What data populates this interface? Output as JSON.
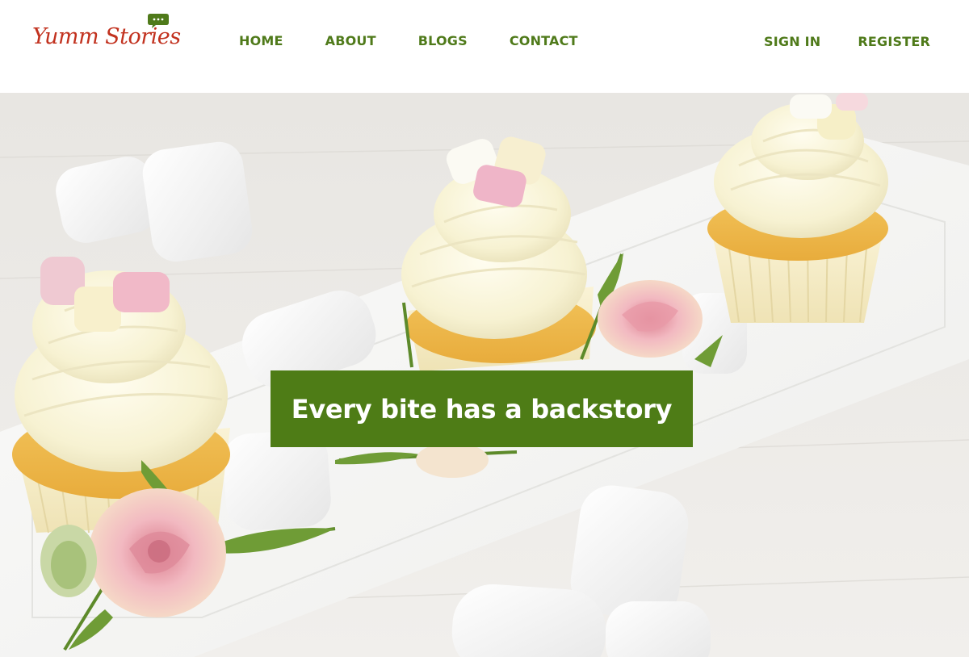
{
  "brand": {
    "logo_text": "Yumm Stories"
  },
  "nav": {
    "items": [
      {
        "label": "HOME"
      },
      {
        "label": "ABOUT"
      },
      {
        "label": "BLOGS"
      },
      {
        "label": "CONTACT"
      }
    ]
  },
  "auth": {
    "sign_in": "SIGN IN",
    "register": "REGISTER"
  },
  "hero": {
    "tagline": "Every bite has a backstory"
  },
  "colors": {
    "brand_red": "#c2321f",
    "nav_green": "#4f7a1a",
    "tagline_bg": "#4e7c16"
  }
}
